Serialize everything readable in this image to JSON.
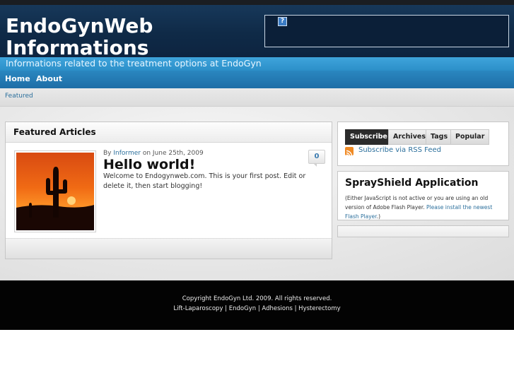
{
  "header": {
    "title_line1": "EndoGynWeb",
    "title_line2": "Informations",
    "tagline": "Informations related to the treatment options at EndoGyn",
    "ad_icon": "broken-image-icon"
  },
  "nav": {
    "items": [
      {
        "label": "Home"
      },
      {
        "label": "About"
      }
    ]
  },
  "breadcrumb": {
    "label": "Featured"
  },
  "featured": {
    "heading": "Featured Articles",
    "post": {
      "meta_by": "By",
      "author": "Informer",
      "meta_on": "on June 25th, 2009",
      "title": "Hello world!",
      "excerpt": "Welcome to Endogynweb.com. This is your first post. Edit or delete it, then start blogging!",
      "comments": "0",
      "thumbnail": "sunset-cactus-image"
    }
  },
  "sidebar": {
    "tabs": [
      {
        "label": "Subscribe"
      },
      {
        "label": "Archives"
      },
      {
        "label": "Tags"
      },
      {
        "label": "Popular"
      }
    ],
    "rss_label": "Subscribe via RSS Feed",
    "rss_icon": "rss-icon",
    "spray": {
      "title": "SprayShield Application",
      "note_prefix": "(Either JavaScript is not active or you are using an old version of Adobe Flash Player.",
      "note_link": "Please install the newest Flash Player",
      "note_suffix": ".)"
    }
  },
  "footer": {
    "copyright": "Copyright EndoGyn Ltd. 2009. All rights reserved.",
    "links": [
      "Lift-Laparoscopy",
      "EndoGyn",
      "Adhesions",
      "Hysterectomy"
    ],
    "separator": " | "
  },
  "colors": {
    "header_bg": "#0f2a47",
    "tagline_band": "#3ea4dc",
    "nav_bg": "#2a87c0",
    "link": "#2b6f9c",
    "footer_bg": "#030303"
  }
}
